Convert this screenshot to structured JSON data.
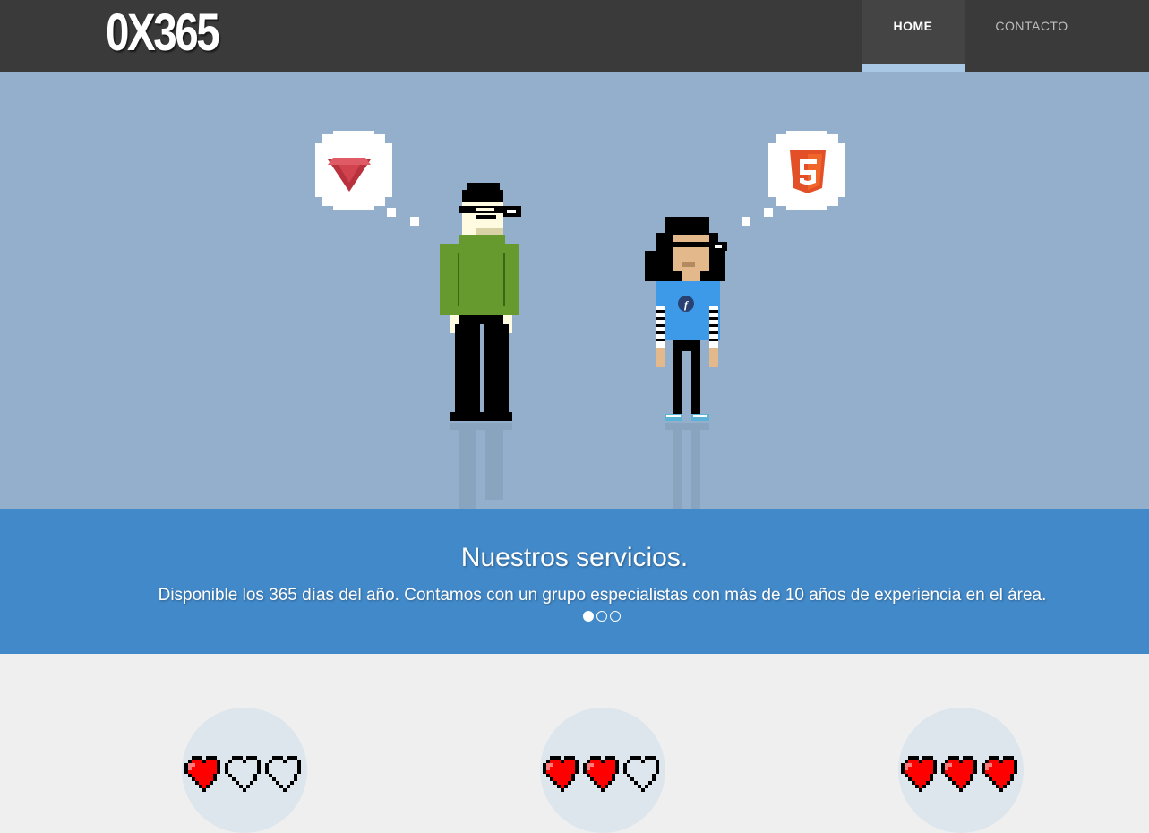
{
  "header": {
    "logo": "0X365",
    "nav": [
      {
        "label": "HOME",
        "active": true
      },
      {
        "label": "CONTACTO",
        "active": false
      }
    ]
  },
  "hero": {
    "left_bubble_icon": "ruby-gem-icon",
    "right_bubble_icon": "html5-icon",
    "right_shirt_icon": "fedora-icon"
  },
  "slider": {
    "title": "Nuestros servicios.",
    "text": "Disponible los 365 días del año. Contamos con un grupo especialistas con más de 10 años de experiencia en el área.",
    "slide_count": 3,
    "active_slide": 1
  },
  "ratings": [
    {
      "filled": 1,
      "total": 3
    },
    {
      "filled": 2,
      "total": 3
    },
    {
      "filled": 3,
      "total": 3
    }
  ],
  "colors": {
    "header_bg": "#3a3a3a",
    "hero_bg": "#93afcb",
    "band_bg": "#4289c9",
    "heart_red": "#ff0000"
  }
}
